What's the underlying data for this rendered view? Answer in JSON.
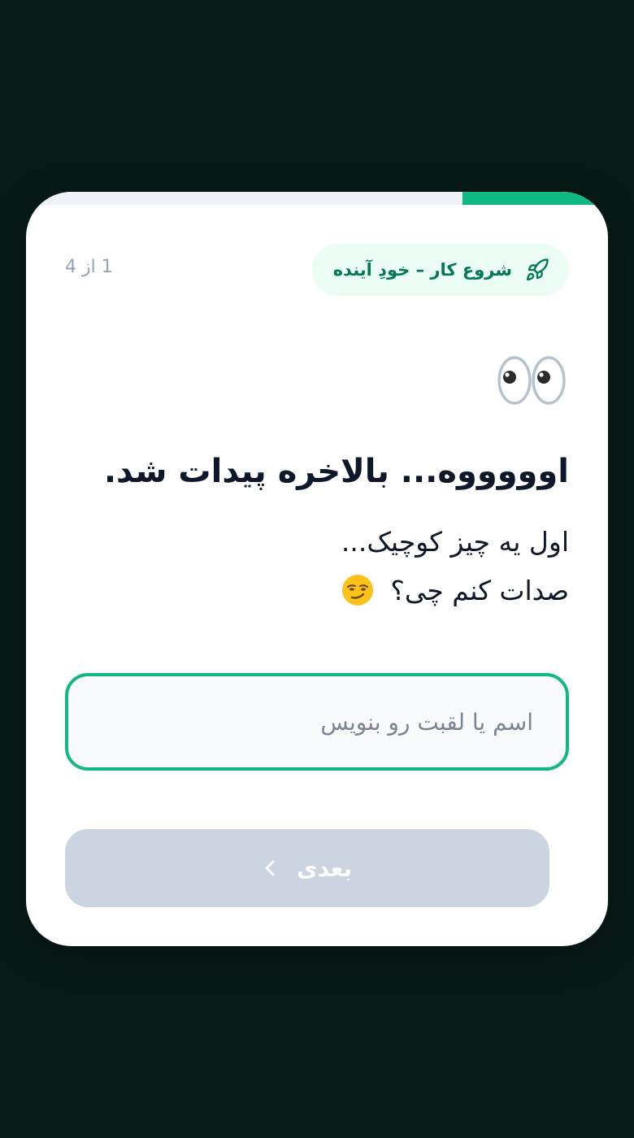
{
  "progress": {
    "fraction": 0.25,
    "fill_color": "#10b981",
    "track_color": "#eef2f7"
  },
  "header": {
    "step_counter": "1 از 4",
    "badge_label": "شروع کار – خودِ آینده",
    "badge_icon": "rocket-icon"
  },
  "content": {
    "emoji": "eyes-emoji",
    "title": "اوووووه... بالاخره پیدات شد.",
    "line1": "اول یه چیز کوچیک...",
    "line2": "صدات کنم چی؟",
    "line2_emoji": "smirk-emoji"
  },
  "input": {
    "value": "",
    "placeholder": "اسم یا لقبت رو بنویس"
  },
  "next_button": {
    "label": "بعدی",
    "icon": "chevron-left-icon"
  },
  "colors": {
    "background": "#071a17",
    "accent": "#10b981",
    "button_disabled": "#cbd5e1"
  }
}
